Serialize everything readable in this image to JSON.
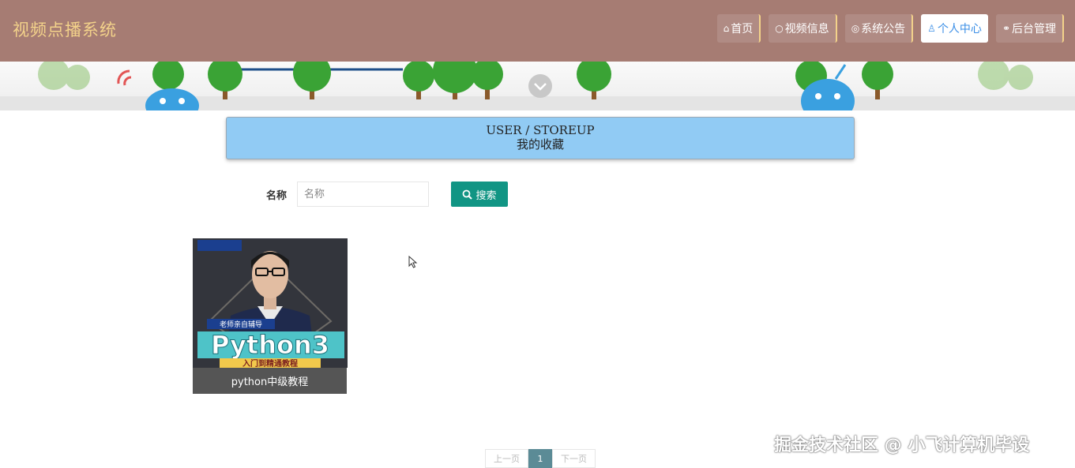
{
  "header": {
    "brand": "视频点播系统",
    "nav": [
      {
        "icon": "⌂",
        "label": "首页"
      },
      {
        "icon": "○",
        "label": "视频信息"
      },
      {
        "icon": "◎",
        "label": "系统公告"
      },
      {
        "icon": "♙",
        "label": "个人中心"
      },
      {
        "icon": "⚭",
        "label": "后台管理"
      }
    ],
    "active_index": 3
  },
  "title_box": {
    "en": "USER / STOREUP",
    "zh": "我的收藏"
  },
  "search": {
    "label": "名称",
    "placeholder": "名称",
    "value": "",
    "button_label": "搜索"
  },
  "cards": [
    {
      "caption": "python中级教程",
      "image_badge": "老师亲自辅导",
      "image_title": "Python3",
      "image_subtitle": "入门到精通教程"
    }
  ],
  "pagination": {
    "prev_label": "上一页",
    "current": "1",
    "next_label": "下一页"
  },
  "watermark": "掘金技术社区 @ 小飞计算机毕设",
  "colors": {
    "header_bg": "#a67c73",
    "brand": "#f3d28a",
    "title_box_bg": "#91cbf4",
    "search_button": "#119584",
    "pager_active": "#5b8b96"
  }
}
